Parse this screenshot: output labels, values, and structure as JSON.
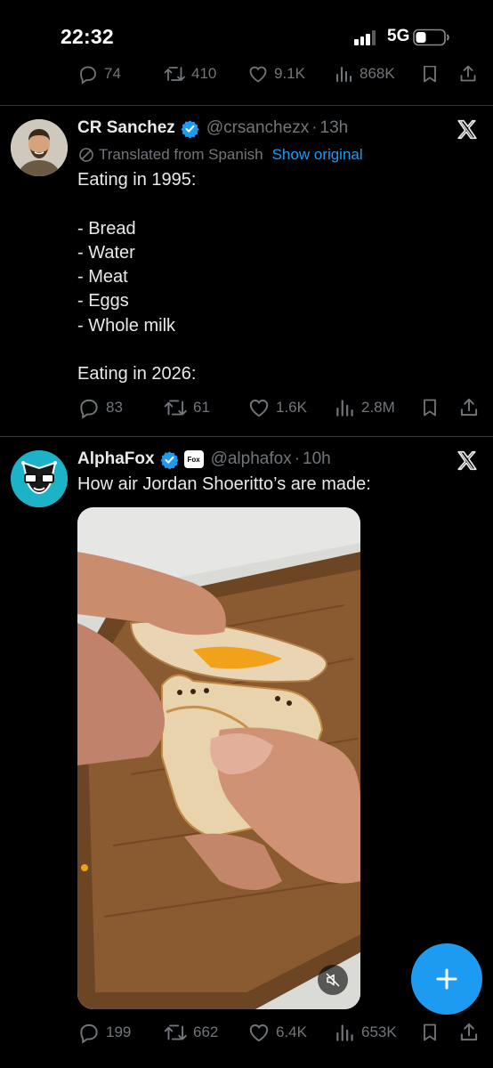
{
  "status_bar": {
    "time": "22:32",
    "network": "5G"
  },
  "top_tweet_actions": {
    "replies": "74",
    "reposts": "410",
    "likes": "9.1K",
    "views": "868K"
  },
  "tweets": [
    {
      "display_name": "CR Sanchez",
      "handle": "@crsanchezx",
      "separator": "·",
      "time": "13h",
      "translated_label": "Translated from Spanish",
      "show_original": "Show original",
      "text": "Eating in 1995:\n\n- Bread\n- Water\n- Meat\n- Eggs\n- Whole milk\n\nEating in 2026:",
      "replies": "83",
      "reposts": "61",
      "likes": "1.6K",
      "views": "2.8M"
    },
    {
      "display_name": "AlphaFox",
      "handle": "@alphafox",
      "separator": "·",
      "time": "10h",
      "affiliate_badge": "Fox",
      "text": "How air Jordan Shoeritto’s are made:",
      "replies": "199",
      "reposts": "662",
      "likes": "6.4K",
      "views": "653K"
    }
  ],
  "colors": {
    "accent": "#1d9bf0",
    "muted": "#71767b",
    "text": "#e7e9ea",
    "divider": "#2f3336"
  },
  "icons": [
    "reply-icon",
    "repost-icon",
    "like-icon",
    "views-icon",
    "bookmark-icon",
    "share-icon",
    "x-logo-icon",
    "verified-icon",
    "compose-icon",
    "mute-icon"
  ]
}
